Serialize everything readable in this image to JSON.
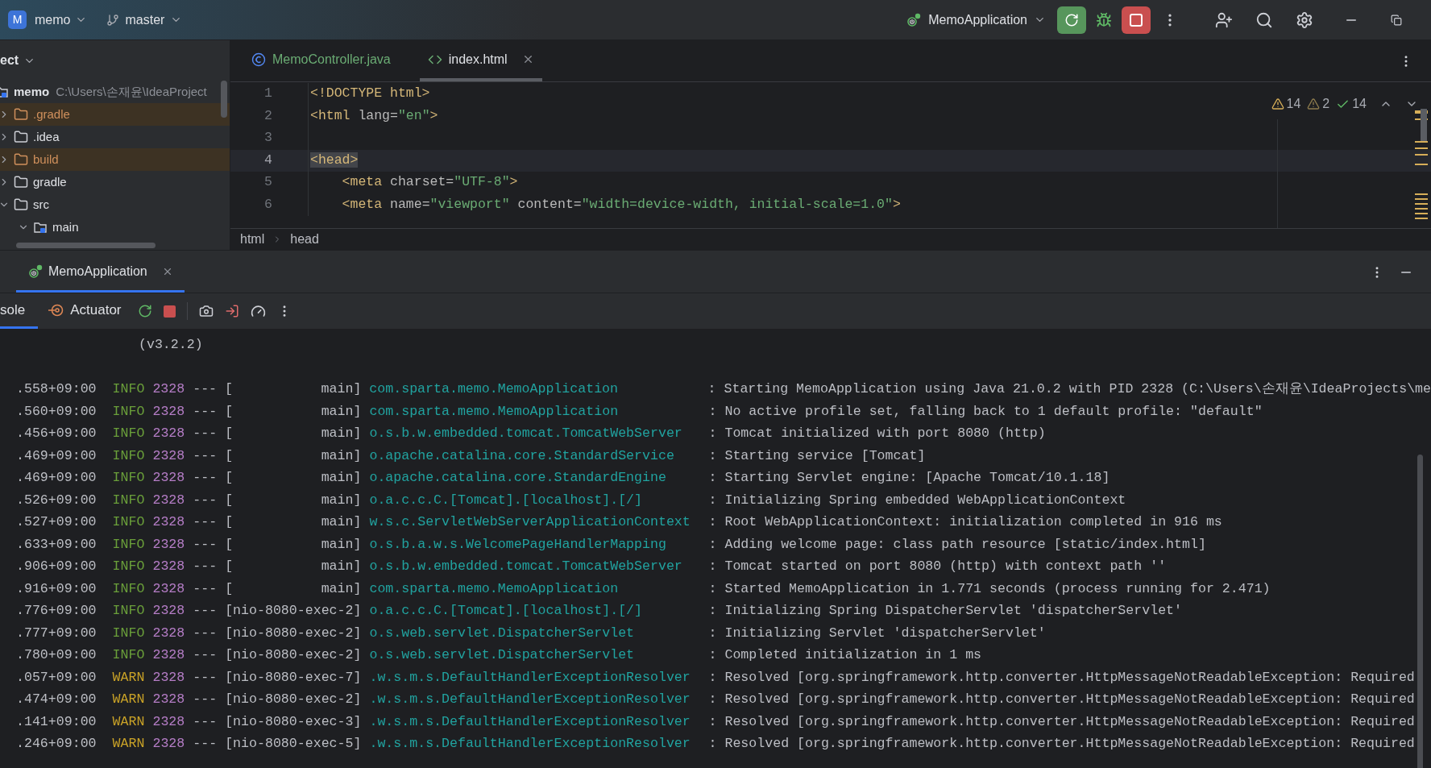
{
  "top_bar": {
    "project": {
      "initial": "M",
      "name": "memo"
    },
    "branch": "master",
    "run_config": "MemoApplication"
  },
  "sidebar": {
    "title": "ect",
    "tree": [
      {
        "name": "memo",
        "path": "C:\\Users\\손재윤\\IdeaProject",
        "expanded": true,
        "excluded": false,
        "kind": "module",
        "children": [
          {
            "name": ".gradle",
            "expanded": false,
            "excluded": true,
            "kind": "folder"
          },
          {
            "name": ".idea",
            "expanded": false,
            "excluded": false,
            "kind": "folder"
          },
          {
            "name": "build",
            "expanded": false,
            "excluded": true,
            "kind": "folder"
          },
          {
            "name": "gradle",
            "expanded": false,
            "excluded": false,
            "kind": "folder"
          },
          {
            "name": "src",
            "expanded": true,
            "excluded": false,
            "kind": "folder",
            "children": [
              {
                "name": "main",
                "expanded": true,
                "excluded": false,
                "kind": "module"
              }
            ]
          }
        ]
      }
    ]
  },
  "editor": {
    "tabs": [
      {
        "label": "MemoController.java",
        "kind": "java",
        "selected": false
      },
      {
        "label": "index.html",
        "kind": "html",
        "selected": true
      }
    ],
    "inspections": {
      "warnings": "14",
      "weak_warnings": "2",
      "typos": "14"
    },
    "lines": [
      {
        "number": "1",
        "current": false,
        "tokens": [
          {
            "kind": "tag",
            "text": "<!DOCTYPE html>"
          }
        ]
      },
      {
        "number": "2",
        "current": false,
        "tokens": [
          {
            "kind": "tag",
            "text": "<html"
          },
          {
            "kind": "attr",
            "text": " lang="
          },
          {
            "kind": "value",
            "text": "\"en\""
          },
          {
            "kind": "tag",
            "text": ">"
          }
        ]
      },
      {
        "number": "3",
        "current": false
      },
      {
        "number": "4",
        "current": true,
        "tokens": [
          {
            "kind": "match",
            "text": "<head>"
          }
        ]
      },
      {
        "number": "5",
        "current": false,
        "tokens": [
          {
            "kind": "tag",
            "text": "    <meta"
          },
          {
            "kind": "attr",
            "text": " charset="
          },
          {
            "kind": "value",
            "text": "\"UTF-8\""
          },
          {
            "kind": "tag",
            "text": ">"
          }
        ]
      },
      {
        "number": "6",
        "current": false,
        "tokens": [
          {
            "kind": "tag",
            "text": "    <meta"
          },
          {
            "kind": "attr",
            "text": " name="
          },
          {
            "kind": "value",
            "text": "\"viewport\""
          },
          {
            "kind": "attr",
            "text": " content="
          },
          {
            "kind": "value",
            "text": "\"width=device-width, initial-scale=1.0\""
          },
          {
            "kind": "tag",
            "text": ">"
          }
        ]
      }
    ],
    "breadcrumb": [
      "html",
      "head"
    ]
  },
  "run_panel": {
    "tabs": [
      {
        "label": "MemoApplication",
        "selected": true
      }
    ],
    "subtabs": [
      {
        "label": "sole",
        "kind": "console",
        "selected": true
      },
      {
        "label": "Actuator",
        "kind": "actuator",
        "selected": false
      }
    ],
    "console": {
      "banner": "(v3.2.2)",
      "rows": [
        {
          "time": ".558+09:00",
          "kind": "info",
          "level": "INFO",
          "pid": "2328",
          "sep": "---",
          "thread": "[           main]",
          "logger": "com.sparta.memo.MemoApplication",
          "colon": ":",
          "message": "Starting MemoApplication using Java 21.0.2 with PID 2328 (C:\\Users\\손재윤\\IdeaProjects\\me"
        },
        {
          "time": ".560+09:00",
          "kind": "info",
          "level": "INFO",
          "pid": "2328",
          "sep": "---",
          "thread": "[           main]",
          "logger": "com.sparta.memo.MemoApplication",
          "colon": ":",
          "message": "No active profile set, falling back to 1 default profile: \"default\""
        },
        {
          "time": ".456+09:00",
          "kind": "info",
          "level": "INFO",
          "pid": "2328",
          "sep": "---",
          "thread": "[           main]",
          "logger": "o.s.b.w.embedded.tomcat.TomcatWebServer",
          "colon": ":",
          "message": "Tomcat initialized with port 8080 (http)"
        },
        {
          "time": ".469+09:00",
          "kind": "info",
          "level": "INFO",
          "pid": "2328",
          "sep": "---",
          "thread": "[           main]",
          "logger": "o.apache.catalina.core.StandardService",
          "colon": ":",
          "message": "Starting service [Tomcat]"
        },
        {
          "time": ".469+09:00",
          "kind": "info",
          "level": "INFO",
          "pid": "2328",
          "sep": "---",
          "thread": "[           main]",
          "logger": "o.apache.catalina.core.StandardEngine",
          "colon": ":",
          "message": "Starting Servlet engine: [Apache Tomcat/10.1.18]"
        },
        {
          "time": ".526+09:00",
          "kind": "info",
          "level": "INFO",
          "pid": "2328",
          "sep": "---",
          "thread": "[           main]",
          "logger": "o.a.c.c.C.[Tomcat].[localhost].[/]",
          "colon": ":",
          "message": "Initializing Spring embedded WebApplicationContext"
        },
        {
          "time": ".527+09:00",
          "kind": "info",
          "level": "INFO",
          "pid": "2328",
          "sep": "---",
          "thread": "[           main]",
          "logger": "w.s.c.ServletWebServerApplicationContext",
          "colon": ":",
          "message": "Root WebApplicationContext: initialization completed in 916 ms"
        },
        {
          "time": ".633+09:00",
          "kind": "info",
          "level": "INFO",
          "pid": "2328",
          "sep": "---",
          "thread": "[           main]",
          "logger": "o.s.b.a.w.s.WelcomePageHandlerMapping",
          "colon": ":",
          "message": "Adding welcome page: class path resource [static/index.html]"
        },
        {
          "time": ".906+09:00",
          "kind": "info",
          "level": "INFO",
          "pid": "2328",
          "sep": "---",
          "thread": "[           main]",
          "logger": "o.s.b.w.embedded.tomcat.TomcatWebServer",
          "colon": ":",
          "message": "Tomcat started on port 8080 (http) with context path ''"
        },
        {
          "time": ".916+09:00",
          "kind": "info",
          "level": "INFO",
          "pid": "2328",
          "sep": "---",
          "thread": "[           main]",
          "logger": "com.sparta.memo.MemoApplication",
          "colon": ":",
          "message": "Started MemoApplication in 1.771 seconds (process running for 2.471)"
        },
        {
          "time": ".776+09:00",
          "kind": "info",
          "level": "INFO",
          "pid": "2328",
          "sep": "---",
          "thread": "[nio-8080-exec-2]",
          "logger": "o.a.c.c.C.[Tomcat].[localhost].[/]",
          "colon": ":",
          "message": "Initializing Spring DispatcherServlet 'dispatcherServlet'"
        },
        {
          "time": ".777+09:00",
          "kind": "info",
          "level": "INFO",
          "pid": "2328",
          "sep": "---",
          "thread": "[nio-8080-exec-2]",
          "logger": "o.s.web.servlet.DispatcherServlet",
          "colon": ":",
          "message": "Initializing Servlet 'dispatcherServlet'"
        },
        {
          "time": ".780+09:00",
          "kind": "info",
          "level": "INFO",
          "pid": "2328",
          "sep": "---",
          "thread": "[nio-8080-exec-2]",
          "logger": "o.s.web.servlet.DispatcherServlet",
          "colon": ":",
          "message": "Completed initialization in 1 ms"
        },
        {
          "time": ".057+09:00",
          "kind": "warn",
          "level": "WARN",
          "pid": "2328",
          "sep": "---",
          "thread": "[nio-8080-exec-7]",
          "logger": ".w.s.m.s.DefaultHandlerExceptionResolver",
          "colon": ":",
          "message": "Resolved [org.springframework.http.converter.HttpMessageNotReadableException: Required"
        },
        {
          "time": ".474+09:00",
          "kind": "warn",
          "level": "WARN",
          "pid": "2328",
          "sep": "---",
          "thread": "[nio-8080-exec-2]",
          "logger": ".w.s.m.s.DefaultHandlerExceptionResolver",
          "colon": ":",
          "message": "Resolved [org.springframework.http.converter.HttpMessageNotReadableException: Required"
        },
        {
          "time": ".141+09:00",
          "kind": "warn",
          "level": "WARN",
          "pid": "2328",
          "sep": "---",
          "thread": "[nio-8080-exec-3]",
          "logger": ".w.s.m.s.DefaultHandlerExceptionResolver",
          "colon": ":",
          "message": "Resolved [org.springframework.http.converter.HttpMessageNotReadableException: Required"
        },
        {
          "time": ".246+09:00",
          "kind": "warn",
          "level": "WARN",
          "pid": "2328",
          "sep": "---",
          "thread": "[nio-8080-exec-5]",
          "logger": ".w.s.m.s.DefaultHandlerExceptionResolver",
          "colon": ":",
          "message": "Resolved [org.springframework.http.converter.HttpMessageNotReadableException: Required"
        }
      ]
    }
  }
}
